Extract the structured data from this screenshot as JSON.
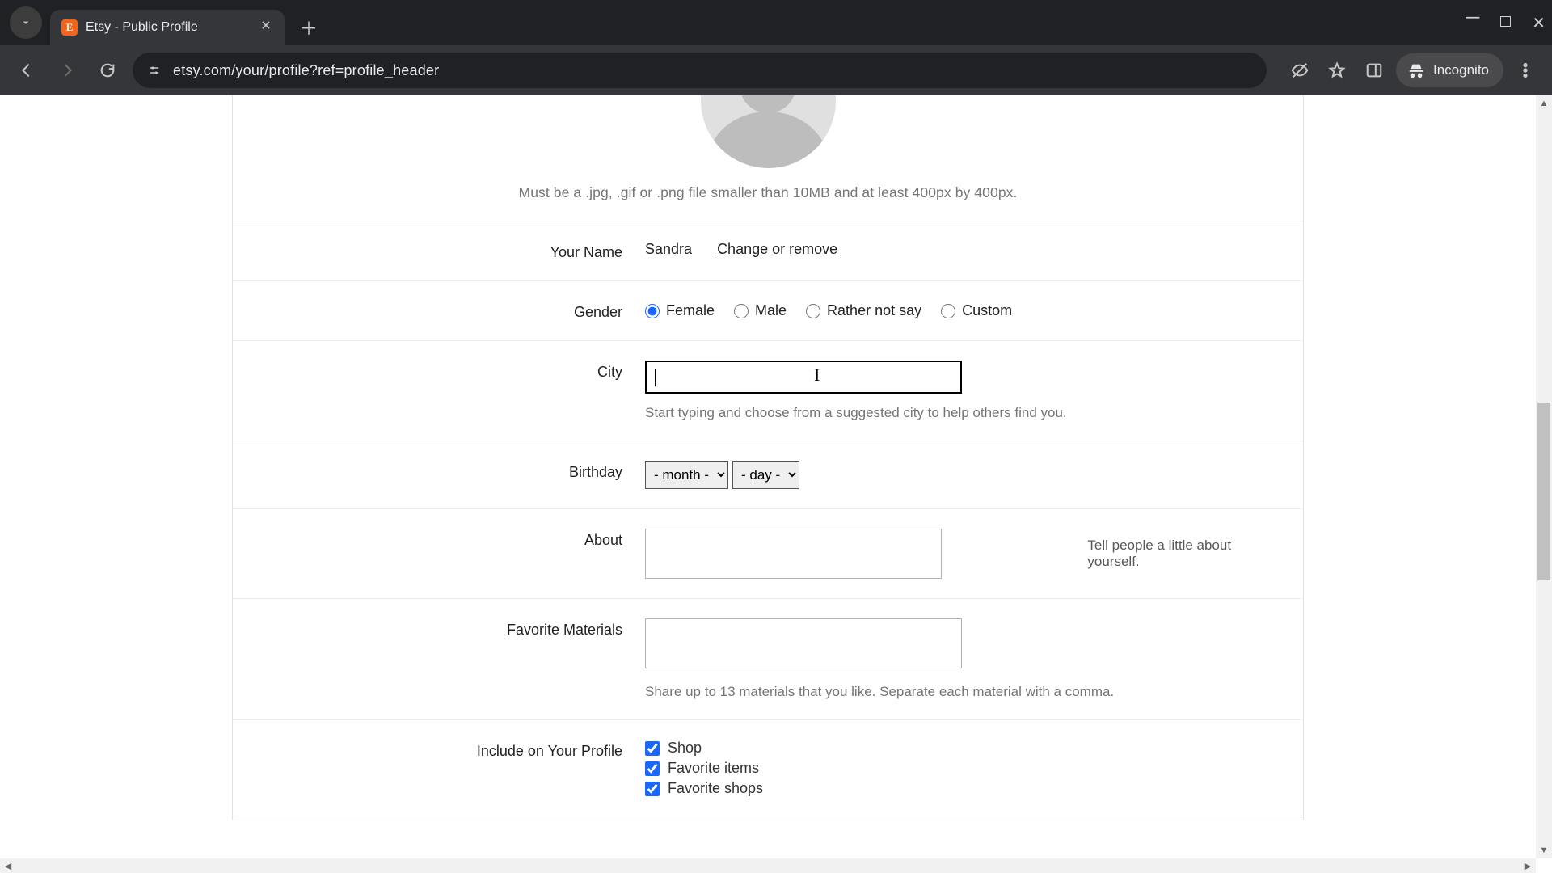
{
  "window": {
    "tab_title": "Etsy - Public Profile",
    "favicon_letter": "E",
    "url": "etsy.com/your/profile?ref=profile_header",
    "incognito_label": "Incognito"
  },
  "profile": {
    "avatar_help": "Must be a .jpg, .gif or .png file smaller than 10MB and at least 400px by 400px.",
    "name_label": "Your Name",
    "name_value": "Sandra",
    "change_link": "Change or remove",
    "gender_label": "Gender",
    "gender_options": {
      "female": "Female",
      "male": "Male",
      "rns": "Rather not say",
      "custom": "Custom"
    },
    "gender_selected": "female",
    "city_label": "City",
    "city_value": "",
    "city_hint": "Start typing and choose from a suggested city to help others find you.",
    "birthday_label": "Birthday",
    "birthday_month_placeholder": "- month -",
    "birthday_day_placeholder": "- day -",
    "about_label": "About",
    "about_hint": "Tell people a little about yourself.",
    "fav_label": "Favorite Materials",
    "fav_hint": "Share up to 13 materials that you like. Separate each material with a comma.",
    "include_label": "Include on Your Profile",
    "include_options": {
      "shop": "Shop",
      "fav_items": "Favorite items",
      "fav_shops": "Favorite shops"
    }
  }
}
